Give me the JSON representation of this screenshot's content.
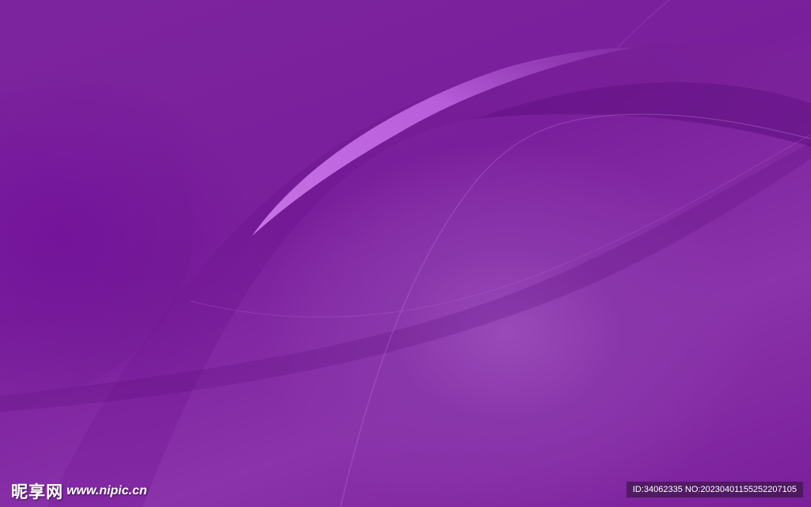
{
  "image": {
    "description_colors": {
      "base": "#7a1f9a",
      "highlight": "#b25fd2",
      "glow": "#9a4bb8"
    }
  },
  "watermark": {
    "brand": "昵享网",
    "url": "www.nipic.cn",
    "id_info": "ID:34062335 NO:20230401155252207105"
  }
}
